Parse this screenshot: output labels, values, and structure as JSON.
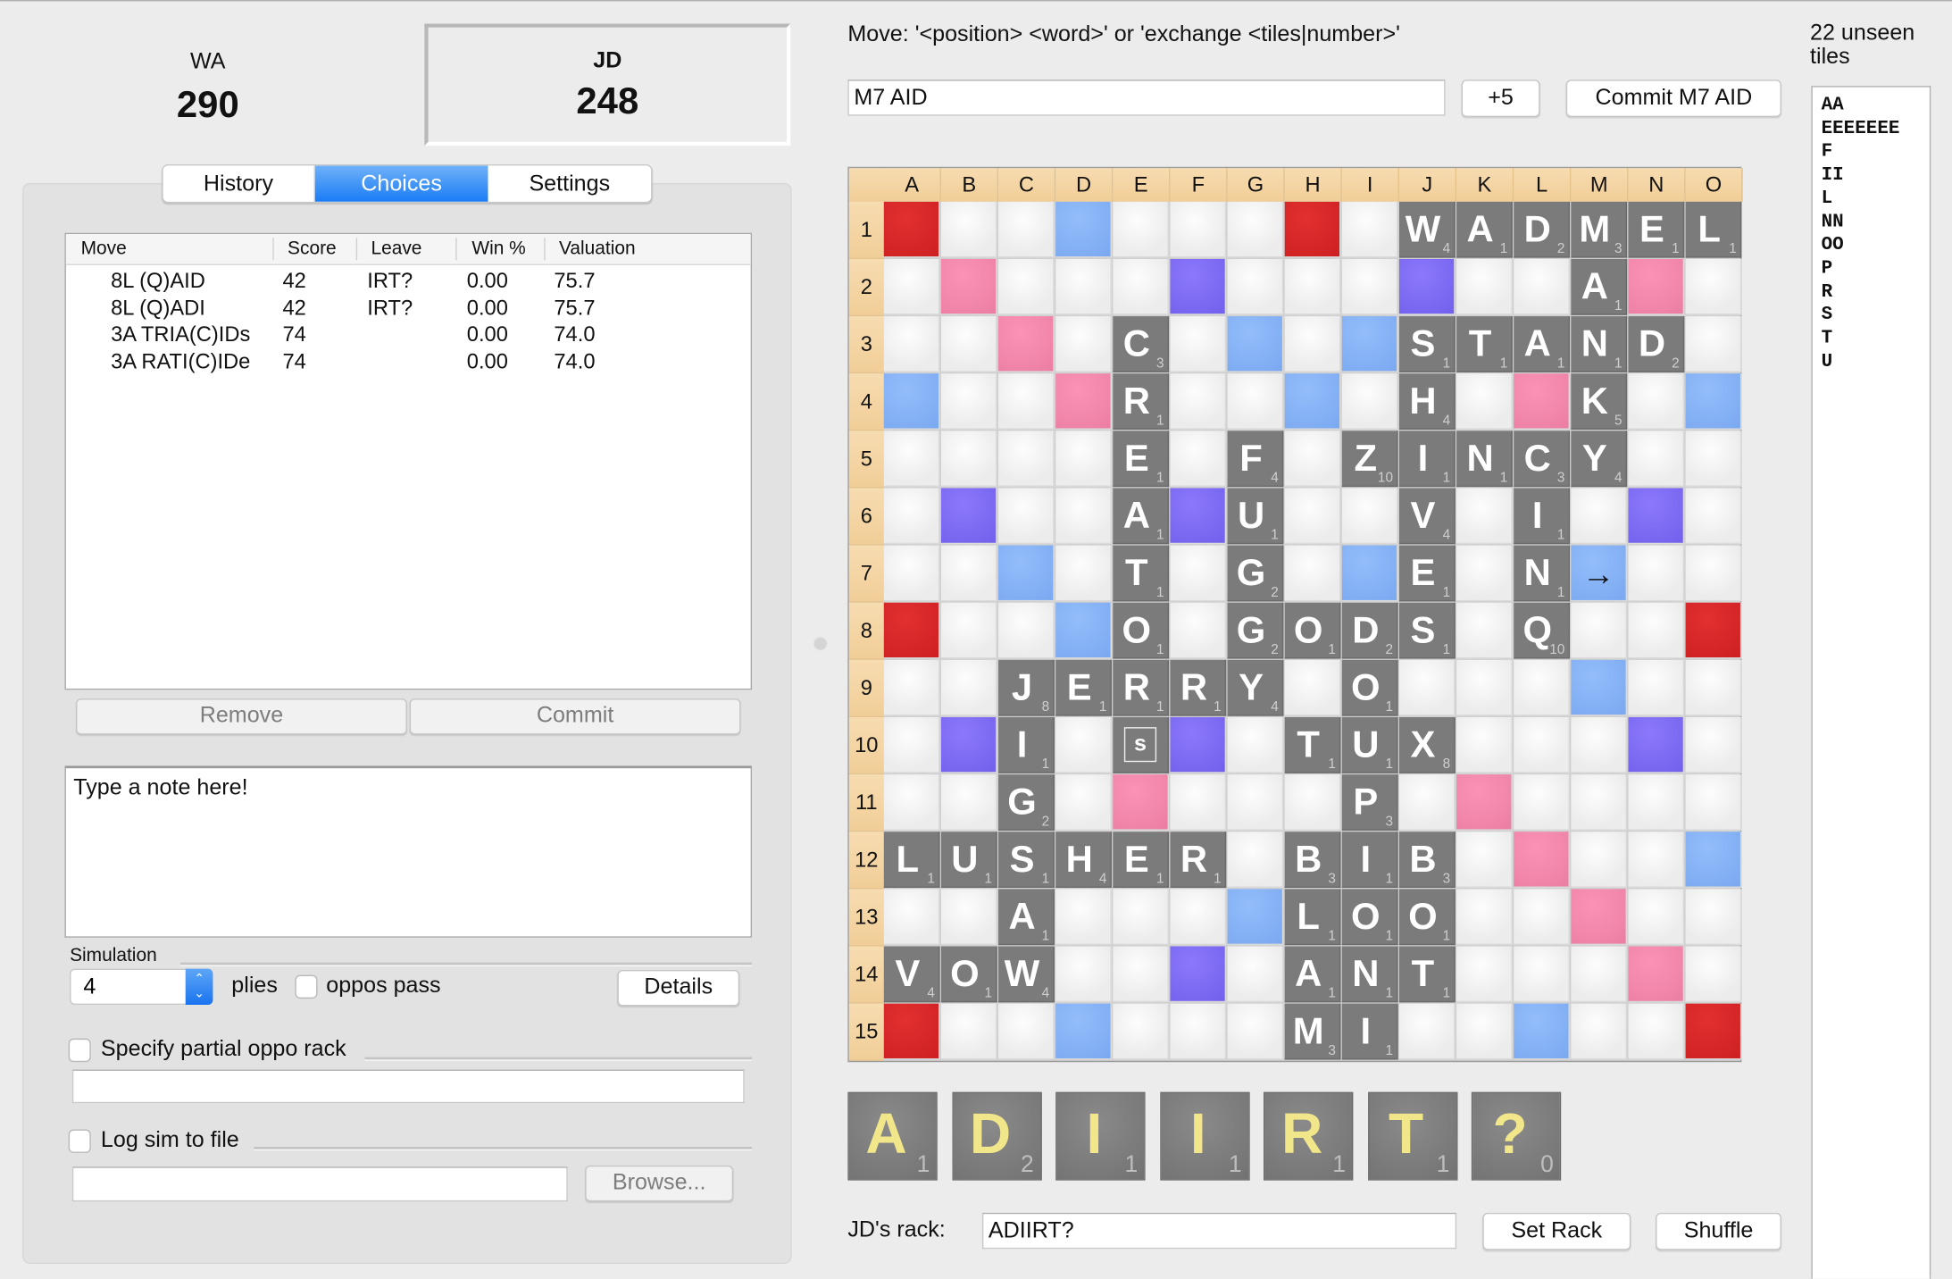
{
  "scores": {
    "players": [
      {
        "name": "WA",
        "score": "290",
        "active": false
      },
      {
        "name": "JD",
        "score": "248",
        "active": true
      }
    ]
  },
  "tabs": [
    {
      "label": "History",
      "selected": false
    },
    {
      "label": "Choices",
      "selected": true
    },
    {
      "label": "Settings",
      "selected": false
    }
  ],
  "choices": {
    "columns": [
      "Move",
      "Score",
      "Leave",
      "Win %",
      "Valuation"
    ],
    "rows": [
      {
        "move": "8L (Q)AID",
        "score": "42",
        "leave": "IRT?",
        "win": "0.00",
        "valuation": "75.7"
      },
      {
        "move": "8L (Q)ADI",
        "score": "42",
        "leave": "IRT?",
        "win": "0.00",
        "valuation": "75.7"
      },
      {
        "move": "3A TRIA(C)IDs",
        "score": "74",
        "leave": "",
        "win": "0.00",
        "valuation": "74.0"
      },
      {
        "move": "3A RATI(C)IDe",
        "score": "74",
        "leave": "",
        "win": "0.00",
        "valuation": "74.0"
      }
    ],
    "remove_label": "Remove",
    "commit_label": "Commit"
  },
  "note": {
    "text": "Type a note here!"
  },
  "simulation": {
    "group_label": "Simulation",
    "plies_value": "4",
    "plies_label": "plies",
    "oppos_pass_label": "oppos pass",
    "oppos_pass_checked": false,
    "details_label": "Details",
    "partial_rack_label": "Specify partial oppo rack",
    "partial_rack_checked": false,
    "partial_rack_value": "",
    "log_label": "Log sim to file",
    "log_checked": false,
    "log_path_value": "",
    "browse_label": "Browse..."
  },
  "move_entry": {
    "instruction": "Move: '<position> <word>' or 'exchange <tiles|number>'",
    "value": "M7 AID",
    "score_button": "+5",
    "commit_button": "Commit M7 AID"
  },
  "board": {
    "columns": [
      "A",
      "B",
      "C",
      "D",
      "E",
      "F",
      "G",
      "H",
      "I",
      "J",
      "K",
      "L",
      "M",
      "N",
      "O"
    ],
    "rows": [
      "1",
      "2",
      "3",
      "4",
      "5",
      "6",
      "7",
      "8",
      "9",
      "10",
      "11",
      "12",
      "13",
      "14",
      "15"
    ],
    "premium": [
      "T..D...T.......",
      ".W...L...L...W.",
      "..W...D.D......",
      "D..W...D...W..D",
      "...............",
      ".L...L.......L.",
      "..D.....D...D..",
      "T..D..........T",
      "............D..",
      ".L...L.......L.",
      "....W.....W....",
      "...........W..D",
      "......D.....W..",
      ".....L.......W.",
      "T..D.......D..T"
    ],
    "premium_legend": {
      "T": "triple-word",
      "W": "double-word",
      "L": "triple-letter",
      "D": "double-letter"
    },
    "tiles": [
      {
        "pos": "J1",
        "letter": "W",
        "points": "4"
      },
      {
        "pos": "K1",
        "letter": "A",
        "points": "1"
      },
      {
        "pos": "L1",
        "letter": "D",
        "points": "2"
      },
      {
        "pos": "M1",
        "letter": "M",
        "points": "3"
      },
      {
        "pos": "N1",
        "letter": "E",
        "points": "1"
      },
      {
        "pos": "O1",
        "letter": "L",
        "points": "1"
      },
      {
        "pos": "M2",
        "letter": "A",
        "points": "1"
      },
      {
        "pos": "E3",
        "letter": "C",
        "points": "3"
      },
      {
        "pos": "J3",
        "letter": "S",
        "points": "1"
      },
      {
        "pos": "K3",
        "letter": "T",
        "points": "1"
      },
      {
        "pos": "L3",
        "letter": "A",
        "points": "1"
      },
      {
        "pos": "M3",
        "letter": "N",
        "points": "1"
      },
      {
        "pos": "N3",
        "letter": "D",
        "points": "2"
      },
      {
        "pos": "E4",
        "letter": "R",
        "points": "1"
      },
      {
        "pos": "J4",
        "letter": "H",
        "points": "4"
      },
      {
        "pos": "M4",
        "letter": "K",
        "points": "5"
      },
      {
        "pos": "E5",
        "letter": "E",
        "points": "1"
      },
      {
        "pos": "G5",
        "letter": "F",
        "points": "4"
      },
      {
        "pos": "I5",
        "letter": "Z",
        "points": "10"
      },
      {
        "pos": "J5",
        "letter": "I",
        "points": "1"
      },
      {
        "pos": "K5",
        "letter": "N",
        "points": "1"
      },
      {
        "pos": "L5",
        "letter": "C",
        "points": "3"
      },
      {
        "pos": "M5",
        "letter": "Y",
        "points": "4"
      },
      {
        "pos": "E6",
        "letter": "A",
        "points": "1"
      },
      {
        "pos": "G6",
        "letter": "U",
        "points": "1"
      },
      {
        "pos": "J6",
        "letter": "V",
        "points": "4"
      },
      {
        "pos": "L6",
        "letter": "I",
        "points": "1"
      },
      {
        "pos": "E7",
        "letter": "T",
        "points": "1"
      },
      {
        "pos": "G7",
        "letter": "G",
        "points": "2"
      },
      {
        "pos": "J7",
        "letter": "E",
        "points": "1"
      },
      {
        "pos": "L7",
        "letter": "N",
        "points": "1"
      },
      {
        "pos": "E8",
        "letter": "O",
        "points": "1"
      },
      {
        "pos": "G8",
        "letter": "G",
        "points": "2"
      },
      {
        "pos": "H8",
        "letter": "O",
        "points": "1"
      },
      {
        "pos": "I8",
        "letter": "D",
        "points": "2"
      },
      {
        "pos": "J8",
        "letter": "S",
        "points": "1"
      },
      {
        "pos": "L8",
        "letter": "Q",
        "points": "10"
      },
      {
        "pos": "C9",
        "letter": "J",
        "points": "8"
      },
      {
        "pos": "D9",
        "letter": "E",
        "points": "1"
      },
      {
        "pos": "E9",
        "letter": "R",
        "points": "1"
      },
      {
        "pos": "F9",
        "letter": "R",
        "points": "1"
      },
      {
        "pos": "G9",
        "letter": "Y",
        "points": "4"
      },
      {
        "pos": "I9",
        "letter": "O",
        "points": "1"
      },
      {
        "pos": "C10",
        "letter": "I",
        "points": "1"
      },
      {
        "pos": "E10",
        "letter": "s",
        "points": "",
        "blank": true
      },
      {
        "pos": "H10",
        "letter": "T",
        "points": "1"
      },
      {
        "pos": "I10",
        "letter": "U",
        "points": "1"
      },
      {
        "pos": "J10",
        "letter": "X",
        "points": "8"
      },
      {
        "pos": "C11",
        "letter": "G",
        "points": "2"
      },
      {
        "pos": "I11",
        "letter": "P",
        "points": "3"
      },
      {
        "pos": "A12",
        "letter": "L",
        "points": "1"
      },
      {
        "pos": "B12",
        "letter": "U",
        "points": "1"
      },
      {
        "pos": "C12",
        "letter": "S",
        "points": "1"
      },
      {
        "pos": "D12",
        "letter": "H",
        "points": "4"
      },
      {
        "pos": "E12",
        "letter": "E",
        "points": "1"
      },
      {
        "pos": "F12",
        "letter": "R",
        "points": "1"
      },
      {
        "pos": "H12",
        "letter": "B",
        "points": "3"
      },
      {
        "pos": "I12",
        "letter": "I",
        "points": "1"
      },
      {
        "pos": "J12",
        "letter": "B",
        "points": "3"
      },
      {
        "pos": "C13",
        "letter": "A",
        "points": "1"
      },
      {
        "pos": "H13",
        "letter": "L",
        "points": "1"
      },
      {
        "pos": "I13",
        "letter": "O",
        "points": "1"
      },
      {
        "pos": "J13",
        "letter": "O",
        "points": "1"
      },
      {
        "pos": "A14",
        "letter": "V",
        "points": "4"
      },
      {
        "pos": "B14",
        "letter": "O",
        "points": "1"
      },
      {
        "pos": "C14",
        "letter": "W",
        "points": "4"
      },
      {
        "pos": "H14",
        "letter": "A",
        "points": "1"
      },
      {
        "pos": "I14",
        "letter": "N",
        "points": "1"
      },
      {
        "pos": "J14",
        "letter": "T",
        "points": "1"
      },
      {
        "pos": "H15",
        "letter": "M",
        "points": "3"
      },
      {
        "pos": "I15",
        "letter": "I",
        "points": "1"
      }
    ],
    "cursor": {
      "pos": "M7",
      "direction": "right-arrow",
      "glyph": "→"
    }
  },
  "rack": {
    "tiles": [
      {
        "letter": "A",
        "points": "1"
      },
      {
        "letter": "D",
        "points": "2"
      },
      {
        "letter": "I",
        "points": "1"
      },
      {
        "letter": "I",
        "points": "1"
      },
      {
        "letter": "R",
        "points": "1"
      },
      {
        "letter": "T",
        "points": "1"
      },
      {
        "letter": "?",
        "points": "0"
      }
    ],
    "label": "JD's rack:",
    "value": "ADIIRT?",
    "set_rack_label": "Set Rack",
    "shuffle_label": "Shuffle"
  },
  "unseen": {
    "title": "22 unseen tiles",
    "lines": [
      "AA",
      "EEEEEEE",
      "F",
      "II",
      "L",
      "NN",
      "OO",
      "P",
      "R",
      "S",
      "T",
      "U"
    ]
  },
  "colors": {
    "accent_tab": "#1a7cf5",
    "triple_word": "#d3232a",
    "double_word": "#f28bb0",
    "triple_letter": "#7a68f4",
    "double_letter": "#88b3f6",
    "tile": "#7b7b7b",
    "rack_letter": "#f2e68a"
  }
}
